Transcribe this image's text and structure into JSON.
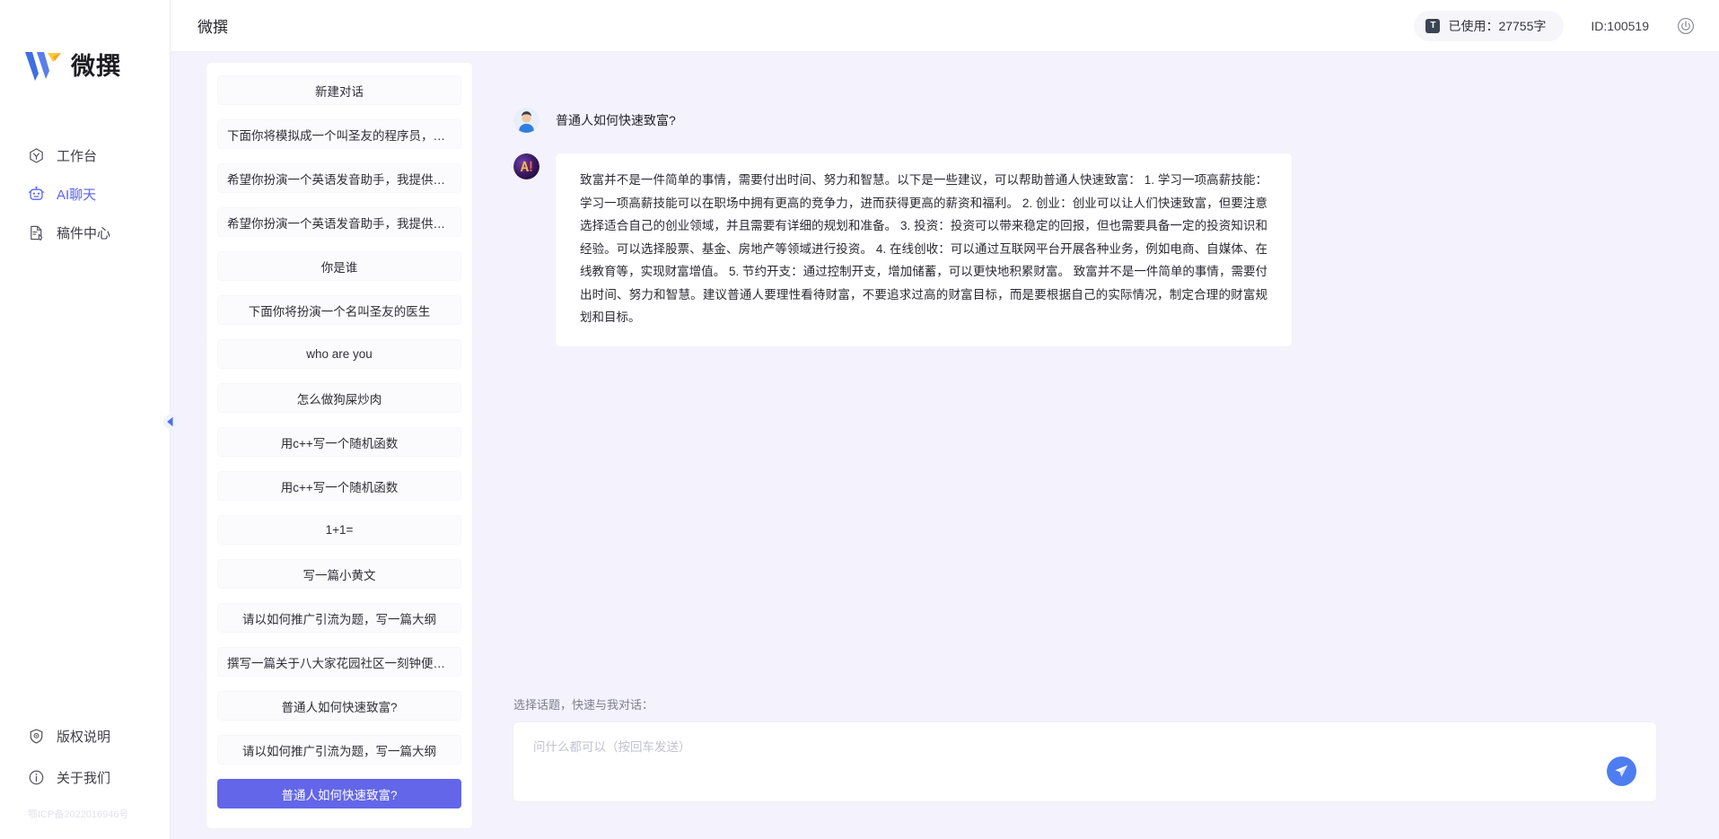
{
  "brand": {
    "name": "微撰",
    "logo_icon": "w-logo-icon"
  },
  "nav": {
    "items": [
      {
        "label": "工作台",
        "icon": "workbench-icon",
        "active": false
      },
      {
        "label": "AI聊天",
        "icon": "robot-icon",
        "active": true
      },
      {
        "label": "稿件中心",
        "icon": "document-edit-icon",
        "active": false
      }
    ],
    "bottom_items": [
      {
        "label": "版权说明",
        "icon": "shield-icon"
      },
      {
        "label": "关于我们",
        "icon": "info-icon"
      }
    ],
    "icp": "鄂ICP备2022016946号",
    "collapse_icon": "chevron-left-icon"
  },
  "topbar": {
    "title": "微撰",
    "usage_label": "已使用：27755字",
    "usage_icon": "token-icon",
    "usage_count": "27755",
    "user_id": "ID:100519",
    "power_icon": "power-icon"
  },
  "conversations": {
    "new_chat_label": "新建对话",
    "items": [
      {
        "label": "下面你将模拟成一个叫圣友的程序员，我说...",
        "selected": false
      },
      {
        "label": "希望你扮演一个英语发音助手，我提供给你...",
        "selected": false
      },
      {
        "label": "希望你扮演一个英语发音助手，我提供给你...",
        "selected": false
      },
      {
        "label": "你是谁",
        "selected": false
      },
      {
        "label": "下面你将扮演一个名叫圣友的医生",
        "selected": false
      },
      {
        "label": "who are you",
        "selected": false
      },
      {
        "label": "怎么做狗屎炒肉",
        "selected": false
      },
      {
        "label": "用c++写一个随机函数",
        "selected": false
      },
      {
        "label": "用c++写一个随机函数",
        "selected": false
      },
      {
        "label": "1+1=",
        "selected": false
      },
      {
        "label": "写一篇小黄文",
        "selected": false
      },
      {
        "label": "请以如何推广引流为题，写一篇大纲",
        "selected": false
      },
      {
        "label": "撰写一篇关于八大家花园社区一刻钟便民生...",
        "selected": false
      },
      {
        "label": "普通人如何快速致富?",
        "selected": false
      },
      {
        "label": "请以如何推广引流为题，写一篇大纲",
        "selected": false
      },
      {
        "label": "普通人如何快速致富?",
        "selected": true
      }
    ]
  },
  "chat": {
    "messages": [
      {
        "role": "user",
        "avatar_icon": "user-avatar-icon",
        "text": "普通人如何快速致富?"
      },
      {
        "role": "assistant",
        "avatar_icon": "ai-avatar-icon",
        "text": "致富并不是一件简单的事情，需要付出时间、努力和智慧。以下是一些建议，可以帮助普通人快速致富： 1. 学习一项高薪技能：学习一项高薪技能可以在职场中拥有更高的竞争力，进而获得更高的薪资和福利。 2. 创业：创业可以让人们快速致富，但要注意选择适合自己的创业领域，并且需要有详细的规划和准备。 3. 投资：投资可以带来稳定的回报，但也需要具备一定的投资知识和经验。可以选择股票、基金、房地产等领域进行投资。 4. 在线创收：可以通过互联网平台开展各种业务，例如电商、自媒体、在线教育等，实现财富增值。 5. 节约开支：通过控制开支，增加储蓄，可以更快地积累财富。 致富并不是一件简单的事情，需要付出时间、努力和智慧。建议普通人要理性看待财富，不要追求过高的财富目标，而是要根据自己的实际情况，制定合理的财富规划和目标。"
      }
    ]
  },
  "composer": {
    "hint": "选择话题，快速与我对话：",
    "placeholder": "问什么都可以（按回车发送）",
    "value": "",
    "send_icon": "send-paper-plane-icon"
  },
  "colors": {
    "accent": "#6366e8",
    "nav_active": "#5a63f0",
    "page_bg": "#f4f2fd",
    "panel_bg": "#ffffff",
    "send_btn": "#4e7df0"
  }
}
